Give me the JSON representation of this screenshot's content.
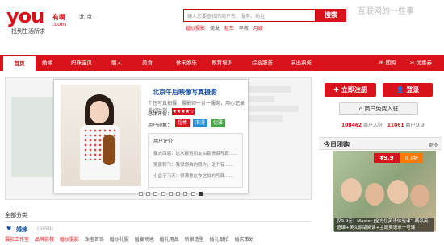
{
  "header": {
    "logo_main": "you",
    "logo_cn": "有啊",
    "logo_com": ".com",
    "tagline": "找到生活所求",
    "city": "北 京",
    "search_placeholder": "输入您要查找的商户名，服务、地址",
    "search_button": "搜索",
    "hot_links": [
      {
        "label": "婚纱摄影",
        "color": "red"
      },
      {
        "label": "美发",
        "color": "gray"
      },
      {
        "label": "租车",
        "color": "red"
      },
      {
        "label": "早教",
        "color": "gray"
      },
      {
        "label": "月嫂",
        "color": "red"
      }
    ],
    "watermark": "互联网的一些事"
  },
  "nav": {
    "items": [
      "首页",
      "婚嫁",
      "妈咪宝贝",
      "丽人",
      "美食",
      "休闲娱乐",
      "教育培训",
      "综合服务",
      "演出票务"
    ],
    "active": 0,
    "right": [
      "团购",
      "优惠券"
    ]
  },
  "popup": {
    "title": "北京午后映像写真摄影",
    "desc": "个性写真拍摄，摄影师一对一服务，用心记录美好时刻",
    "rating_label": "总体评价：",
    "stars": "★★★★☆",
    "impress_label": "用户印象：",
    "tags": [
      {
        "label": "超棒",
        "color": "#d8131b"
      },
      {
        "label": "浪漫",
        "color": "#1f8fd6"
      },
      {
        "label": "优雅",
        "color": "#4aa34a"
      }
    ],
    "review_title": "用户评价",
    "reviews": [
      "要去西塘：这次跟男朋友拍套情侣写真……",
      "冤家我飞：我很想拍的照片，是个有……",
      "小盒子飞天：很满意在你这拍的写真……"
    ]
  },
  "dots": {
    "count": 9,
    "active": 8
  },
  "sidebar": {
    "register": "立即注册",
    "login": "登录",
    "merchant": "商户免费入驻",
    "stats_merchant_count": "108462",
    "stats_merchant_label": "商户入驻",
    "stats_cert_count": "11061",
    "stats_cert_label": "商户认证"
  },
  "group": {
    "title": "今日团购",
    "more": "更多",
    "price": "¥9.9",
    "discount": "0.1折",
    "caption": "仅9.9元！Master J全方位英语体验课：精品英语课+英文原版阅读+主题英语单一号课"
  },
  "categories": {
    "title": "全部分类",
    "wedding": "婚嫁",
    "wedding_count": "(6959)",
    "links": [
      {
        "label": "摄影工作室",
        "color": "red"
      },
      {
        "label": "品牌影楼",
        "color": "red"
      },
      {
        "label": "婚纱摄影",
        "color": "red"
      },
      {
        "label": "珠宝首饰",
        "color": "gray"
      },
      {
        "label": "婚纱礼服",
        "color": "gray"
      },
      {
        "label": "婚宴场地",
        "color": "gray"
      },
      {
        "label": "婚礼用品",
        "color": "gray"
      },
      {
        "label": "新娘造型",
        "color": "gray"
      },
      {
        "label": "婚礼跟拍",
        "color": "gray"
      },
      {
        "label": "婚庆策划",
        "color": "gray"
      }
    ]
  },
  "colors": {
    "brand": "#d8131b",
    "link_blue": "#1a4fa0",
    "orange": "#ff7800"
  }
}
